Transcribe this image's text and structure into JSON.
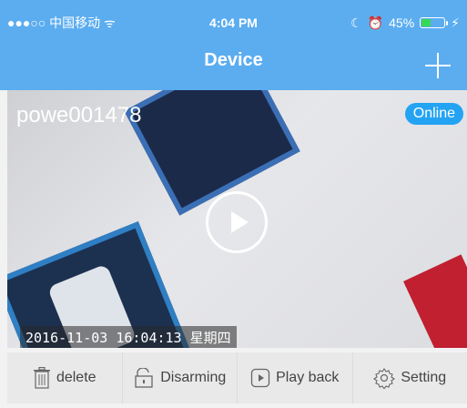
{
  "status_bar": {
    "carrier": "●●●○○ 中国移动 ᯤ",
    "time": "4:04 PM",
    "battery_percent": "45%",
    "battery_level": 0.45
  },
  "nav": {
    "title": "Device",
    "add_icon": "plus-icon"
  },
  "camera": {
    "name": "powe001478",
    "status": "Online",
    "timestamp": "2016-11-03 16:04:13 星期四",
    "play_icon": "play-icon"
  },
  "toolbar": {
    "delete_label": "delete",
    "disarming_label": "Disarming",
    "playback_label": "Play back",
    "setting_label": "Setting"
  },
  "colors": {
    "header": "#5badf0",
    "badge": "#24a3f3",
    "toolbar_bg": "#e9e9e9"
  }
}
